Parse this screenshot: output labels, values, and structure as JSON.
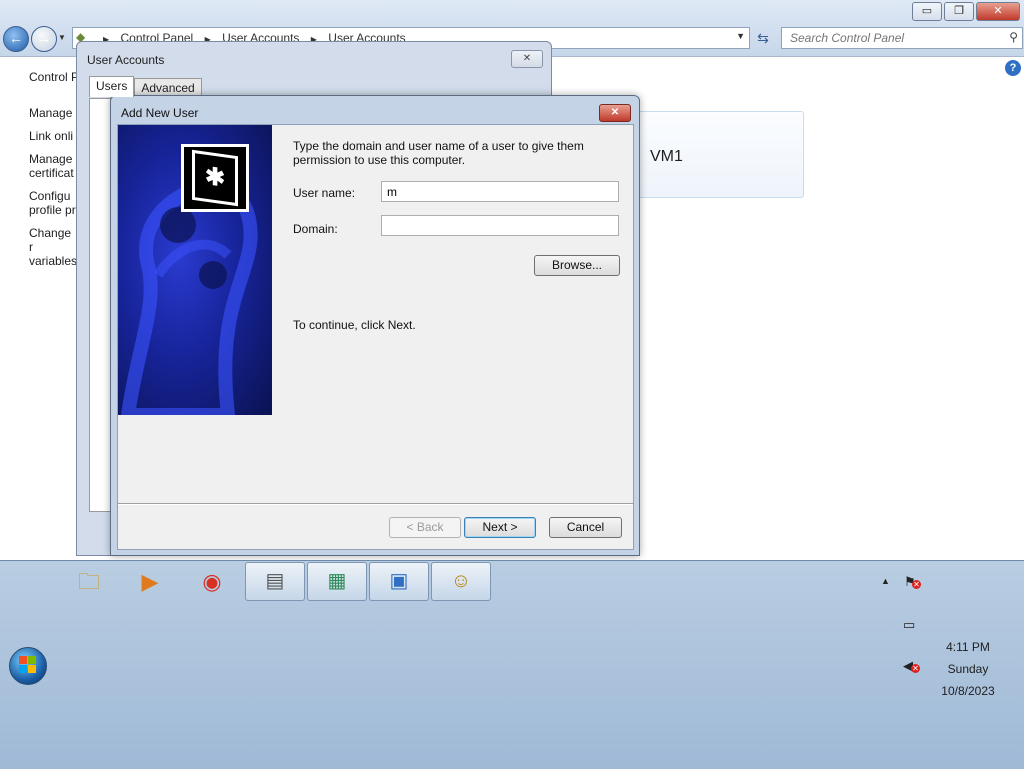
{
  "explorer": {
    "window_buttons": {
      "minimize": "▭",
      "restore": "❐",
      "close": "✕"
    },
    "address": {
      "crumbs": [
        "Control Panel",
        "User Accounts",
        "User Accounts"
      ]
    },
    "search": {
      "placeholder": "Search Control Panel"
    },
    "left_links": {
      "title": "Control P",
      "items": [
        "Manage",
        "Link onli",
        "Manage certificat",
        "Configu profile pr",
        "Change r variables"
      ]
    },
    "user_tile": {
      "name": "VM1"
    },
    "help": "?"
  },
  "user_accounts_dialog": {
    "title": "User Accounts",
    "close_glyph": "✕",
    "tabs": [
      "Users",
      "Advanced"
    ]
  },
  "add_user_wizard": {
    "title": "Add New User",
    "close_glyph": "✕",
    "intro": "Type the domain and user name of a user to give them permission to use this computer.",
    "username_label": "User name:",
    "username_value": "m",
    "domain_label": "Domain:",
    "domain_value": "",
    "browse_label": "Browse...",
    "continue_text": "To continue, click Next.",
    "back_label": "< Back",
    "next_label": "Next >",
    "cancel_label": "Cancel"
  },
  "taskbar": {
    "pinned": [
      {
        "name": "windows-explorer-icon",
        "glyph": "🗀"
      },
      {
        "name": "media-player-icon",
        "glyph": "▶"
      },
      {
        "name": "chrome-icon",
        "glyph": "◉"
      }
    ],
    "running": [
      {
        "name": "server-manager-icon",
        "glyph": "▤"
      },
      {
        "name": "component-services-icon",
        "glyph": "▦"
      },
      {
        "name": "control-panel-icon",
        "glyph": "▣"
      },
      {
        "name": "user-accounts-icon",
        "glyph": "☺"
      }
    ],
    "clock": {
      "time": "4:11 PM",
      "day": "Sunday",
      "date": "10/8/2023"
    }
  },
  "colors": {
    "accent": "#1f5aa8",
    "taskbar": "#b9cde2",
    "wizard_banner": "#17249a",
    "close_red": "#c0392b"
  }
}
